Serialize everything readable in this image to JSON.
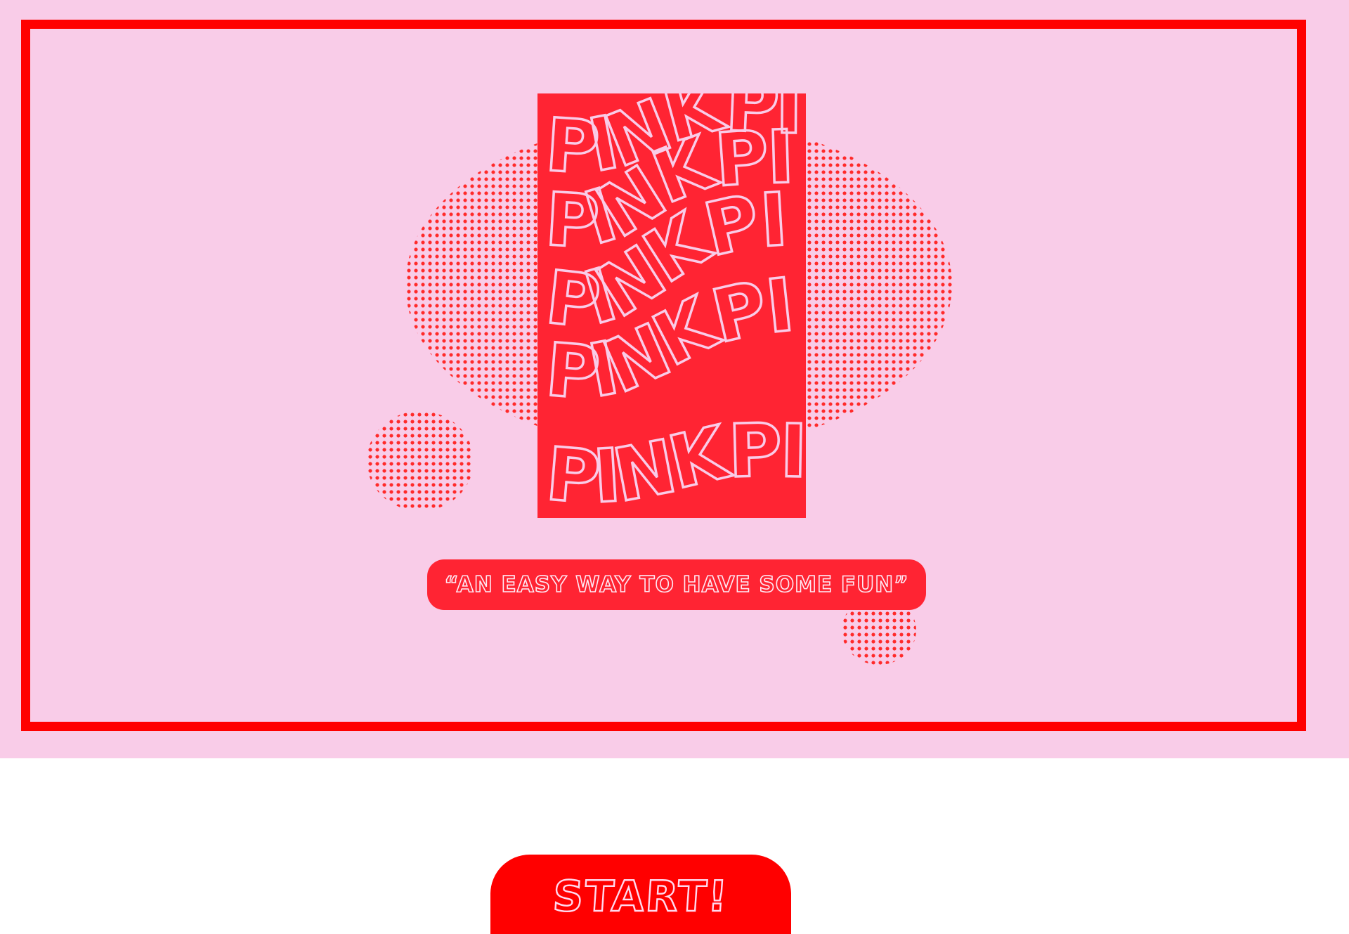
{
  "poster": {
    "word": "PINKPINK",
    "lines": [
      "PINKPINK",
      "PINKPINK",
      "PINKPINK",
      "PINKPINK",
      "PINKPINK"
    ]
  },
  "tagline": {
    "text": "“AN EASY WAY TO HAVE SOME FUN”"
  },
  "start_button": {
    "label": "START!"
  },
  "colors": {
    "background_pink": "#f9cce8",
    "frame_red": "#ff0000",
    "accent_red": "#ff2433",
    "dot_red": "#ff2a2a"
  }
}
